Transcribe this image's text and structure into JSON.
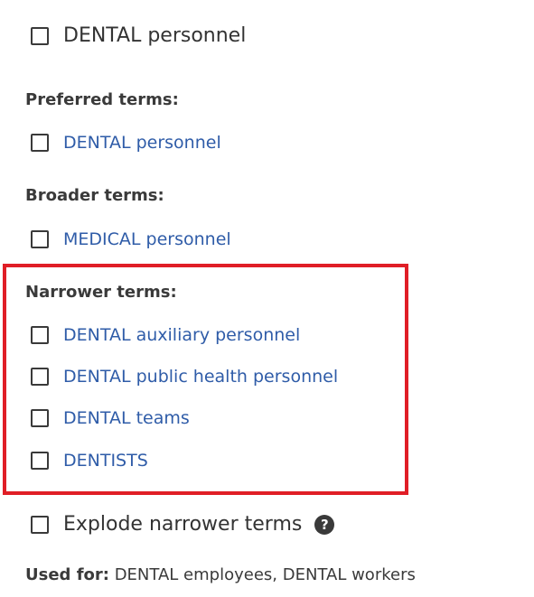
{
  "main_term": "DENTAL personnel",
  "preferred": {
    "heading": "Preferred terms:",
    "items": [
      "DENTAL personnel"
    ]
  },
  "broader": {
    "heading": "Broader terms:",
    "items": [
      "MEDICAL personnel"
    ]
  },
  "narrower": {
    "heading": "Narrower terms:",
    "items": [
      "DENTAL auxiliary personnel",
      "DENTAL public health personnel",
      "DENTAL teams",
      "DENTISTS"
    ]
  },
  "explode": {
    "label": "Explode narrower terms",
    "help_icon": "question-circle-icon",
    "help_glyph": "?"
  },
  "used_for": {
    "label": "Used for:",
    "value": " DENTAL employees, DENTAL workers"
  },
  "colors": {
    "link": "#2f5ca8",
    "highlight": "#e01e26"
  }
}
